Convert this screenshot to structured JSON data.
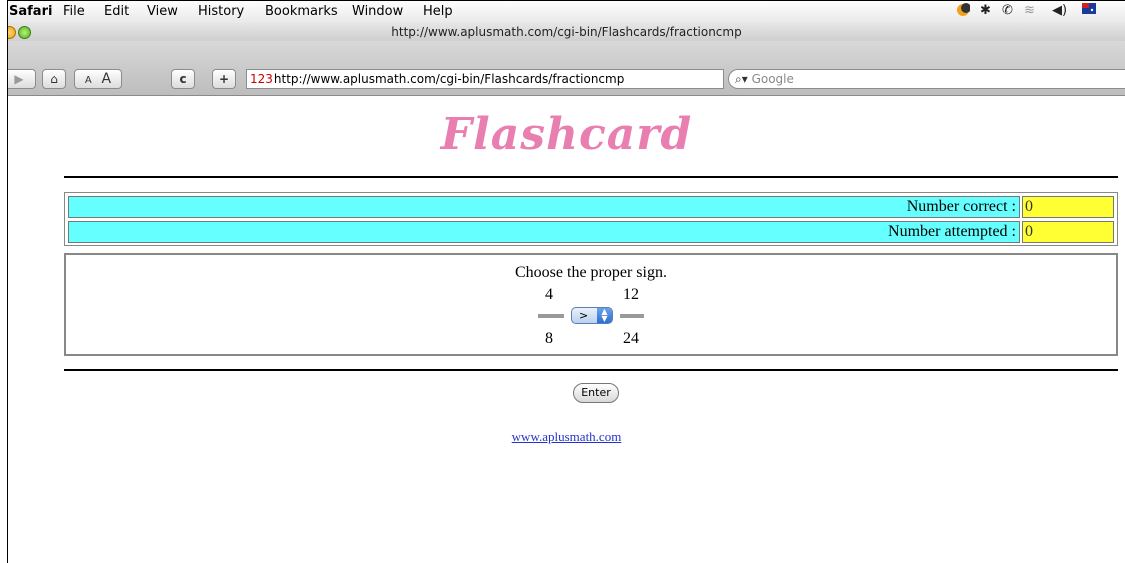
{
  "menubar": {
    "app": "Safari",
    "items": [
      "File",
      "Edit",
      "View",
      "History",
      "Bookmarks",
      "Window",
      "Help"
    ],
    "status_icons": [
      "moon-icon",
      "bluetooth-icon",
      "phone-icon",
      "wifi-icon",
      "volume-icon",
      "flag-icon"
    ]
  },
  "window": {
    "title": "http://www.aplusmath.com/cgi-bin/Flashcards/fractioncmp"
  },
  "toolbar": {
    "small_font": "A",
    "large_font": "A",
    "reload": "c",
    "add": "+",
    "address_prefix": "123",
    "address": "http://www.aplusmath.com/cgi-bin/Flashcards/fractioncmp",
    "search_placeholder": "Google"
  },
  "page": {
    "logo": "Flashcard",
    "number_correct_label": "Number correct :",
    "number_correct_value": "0",
    "number_attempted_label": "Number attempted :",
    "number_attempted_value": "0",
    "prompt": "Choose the proper sign.",
    "left_numerator": "4",
    "left_denominator": "8",
    "right_numerator": "12",
    "right_denominator": "24",
    "sign_selected": ">",
    "enter_label": "Enter",
    "footer_link": "www.aplusmath.com"
  }
}
